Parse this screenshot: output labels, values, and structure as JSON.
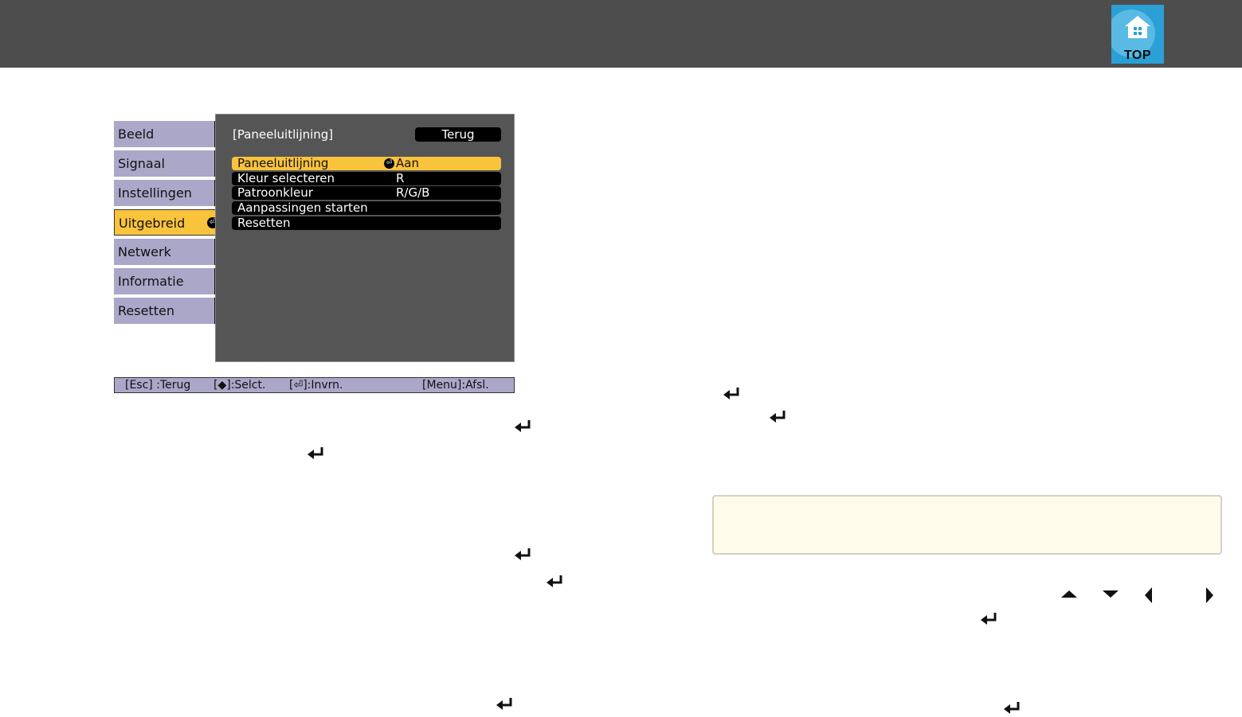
{
  "header": {
    "top_button_label": "TOP",
    "colors": {
      "bar": "#4d4d4d",
      "top_button": "#2aa0d6"
    }
  },
  "osd": {
    "tabs": [
      {
        "label": "Beeld",
        "active": false
      },
      {
        "label": "Signaal",
        "active": false
      },
      {
        "label": "Instellingen",
        "active": false
      },
      {
        "label": "Uitgebreid",
        "active": true
      },
      {
        "label": "Netwerk",
        "active": false
      },
      {
        "label": "Informatie",
        "active": false
      },
      {
        "label": "Resetten",
        "active": false
      }
    ],
    "panel_title": "[Paneeluitlijning]",
    "back_label": "Terug",
    "rows": [
      {
        "label": "Paneeluitlijning",
        "value": "Aan",
        "selected": true
      },
      {
        "label": "Kleur selecteren",
        "value": "R",
        "selected": false
      },
      {
        "label": "Patroonkleur",
        "value": "R/G/B",
        "selected": false
      },
      {
        "label": "Aanpassingen starten",
        "value": "",
        "selected": false
      },
      {
        "label": "Resetten",
        "value": "",
        "selected": false
      }
    ],
    "footer": {
      "esc": "[Esc] :Terug",
      "select": "[◆]:Selct.",
      "enter": "[⏎]:Invrn.",
      "menu": "[Menu]:Afsl."
    },
    "colors": {
      "tab": "#aaa7c9",
      "active": "#f9c33c",
      "panel": "#555555"
    }
  },
  "icons": {
    "enter": "enter-icon",
    "up": "arrow-up-icon",
    "down": "arrow-down-icon",
    "left": "arrow-left-icon",
    "right": "arrow-right-icon"
  },
  "note": {
    "background": "#fffbea"
  }
}
